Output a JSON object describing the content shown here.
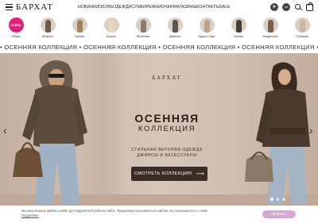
{
  "header": {
    "logo": "БАРХАТ",
    "nav": [
      "НОВИНКИ",
      "ОБУВЬ",
      "ОДЕЖДА",
      "СУМКИ",
      "РЕМНИ",
      "ОЧКИ",
      "МАГАЗИНЫ",
      "КОНТАКТЫ",
      "SALE"
    ]
  },
  "categories": [
    {
      "label": "Обувь",
      "sale_badge": "ОСЕНЬ"
    },
    {
      "label": "Жакеты"
    },
    {
      "label": "Тренчи"
    },
    {
      "label": "Шорты"
    },
    {
      "label": "Футболки"
    },
    {
      "label": "Джинсы"
    },
    {
      "label": "Худи и Свит"
    },
    {
      "label": "Брюки"
    },
    {
      "label": "Кардиганы"
    },
    {
      "label": "Рубашки"
    }
  ],
  "marquee": {
    "text": "ОСЕННЯЯ КОЛЛЕКЦИЯ",
    "separator": "•"
  },
  "hero": {
    "brand": "БАРХАТ",
    "title_line1": "ОСЕННЯЯ",
    "title_line2": "КОЛЛЕКЦИЯ",
    "subtitle_line1": "СТИЛЬНАЯ ВЕРХНЯЯ ОДЕЖДА",
    "subtitle_line2": "ДЖИНСЫ И АКСЕССУАРЫ",
    "cta": "СМОТРЕТЬ КОЛЛЕКЦИЮ",
    "cta_arrow": "⟶",
    "prev_arrow": "‹",
    "next_arrow": "›",
    "slides_total": 3,
    "slide_active": 1
  },
  "cookie": {
    "text": "Мы используем файлы cookie для корректной работы сайта. Продолжая пользоваться сайтом, вы соглашаетесь с этим.",
    "link": "Подробнее",
    "accept": "Принять"
  },
  "colors": {
    "accent_sale": "#e0207a",
    "cta_bg": "#3b2d25",
    "accept_bg": "#d6a9d0"
  }
}
